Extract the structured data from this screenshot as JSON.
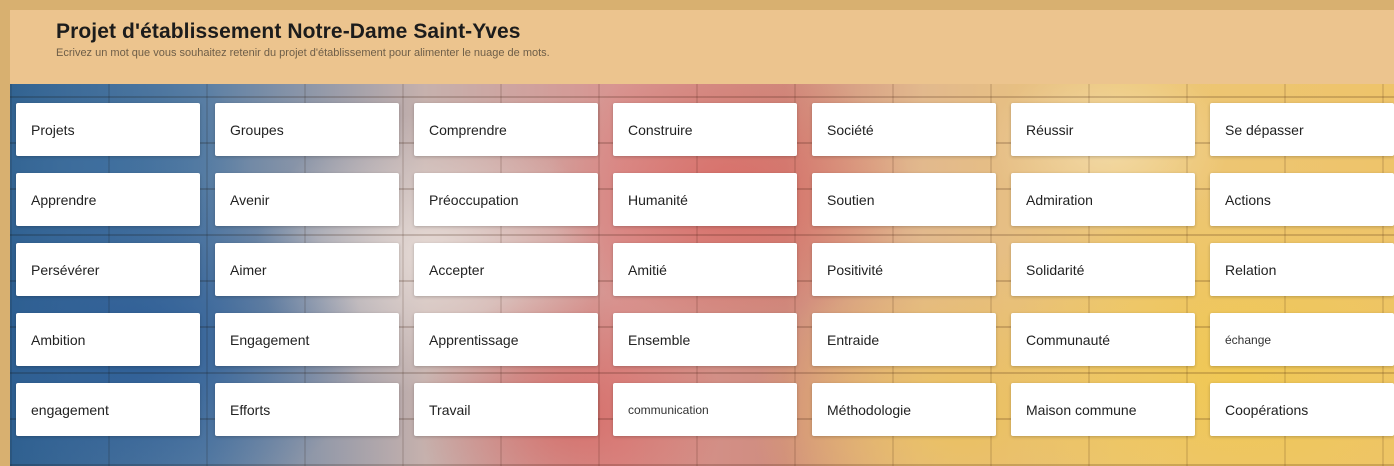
{
  "header": {
    "title": "Projet d'établissement Notre-Dame Saint-Yves",
    "subtitle": "Ecrivez un mot que vous souhaitez retenir du projet d'établissement pour alimenter le nuage de mots."
  },
  "colors": {
    "header_bg": "#ecc48e",
    "card_bg": "#ffffff",
    "text": "#1c1c1c"
  },
  "words": [
    "Projets",
    "Groupes",
    "Comprendre",
    "Construire",
    "Société",
    "Réussir",
    "Se dépasser",
    "Apprendre",
    "Avenir",
    "Préoccupation",
    "Humanité",
    "Soutien",
    "Admiration",
    "Actions",
    "Persévérer",
    "Aimer",
    "Accepter",
    "Amitié",
    "Positivité",
    "Solidarité",
    "Relation",
    "Ambition",
    "Engagement",
    "Apprentissage",
    "Ensemble",
    "Entraide",
    "Communauté",
    "échange",
    "engagement",
    "Efforts",
    "Travail",
    "communication",
    "Méthodologie",
    "Maison commune",
    "Coopérations"
  ]
}
